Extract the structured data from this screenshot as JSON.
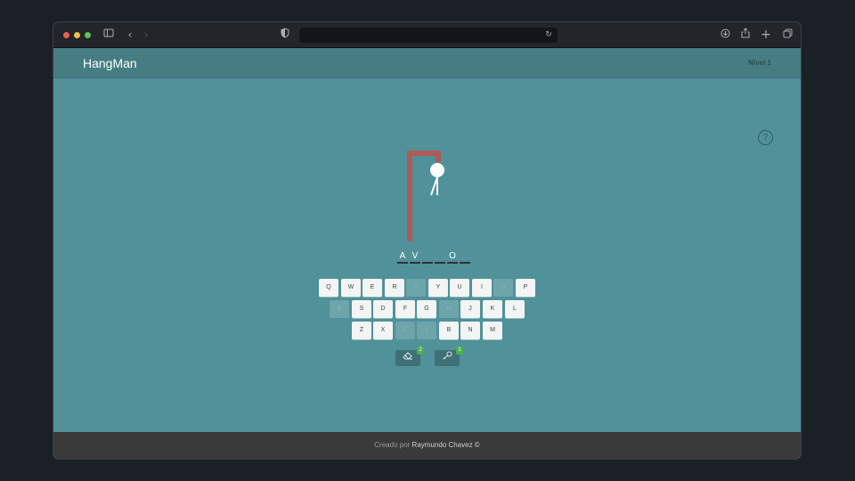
{
  "browser": {
    "icons": {
      "sidebar": "sidebar-icon",
      "back": "back-icon",
      "forward": "forward-icon",
      "shield": "shield-icon",
      "reload": "reload-icon",
      "download": "download-icon",
      "share": "share-icon",
      "new_tab": "plus-icon",
      "tabs": "tabs-icon"
    },
    "url": ""
  },
  "navbar": {
    "brand": "HangMan",
    "level": "Nivel 1"
  },
  "help": {
    "label": "?"
  },
  "word": {
    "slots": [
      "A",
      "V",
      "",
      "",
      "O",
      ""
    ]
  },
  "keyboard": {
    "row1": [
      {
        "label": "Q",
        "used": false
      },
      {
        "label": "W",
        "used": false
      },
      {
        "label": "E",
        "used": false
      },
      {
        "label": "R",
        "used": false
      },
      {
        "label": "T",
        "used": true
      },
      {
        "label": "Y",
        "used": false
      },
      {
        "label": "U",
        "used": false
      },
      {
        "label": "I",
        "used": false
      },
      {
        "label": "O",
        "used": true
      },
      {
        "label": "P",
        "used": false
      }
    ],
    "row2": [
      {
        "label": "A",
        "used": true
      },
      {
        "label": "S",
        "used": false
      },
      {
        "label": "D",
        "used": false
      },
      {
        "label": "F",
        "used": false
      },
      {
        "label": "G",
        "used": false
      },
      {
        "label": "H",
        "used": true
      },
      {
        "label": "J",
        "used": false
      },
      {
        "label": "K",
        "used": false
      },
      {
        "label": "L",
        "used": false
      }
    ],
    "row3": [
      {
        "label": "Z",
        "used": false
      },
      {
        "label": "X",
        "used": false
      },
      {
        "label": "C",
        "used": true
      },
      {
        "label": "V",
        "used": true
      },
      {
        "label": "B",
        "used": false
      },
      {
        "label": "N",
        "used": false
      },
      {
        "label": "M",
        "used": false
      }
    ]
  },
  "hints": {
    "eraser": {
      "icon": "eraser-icon",
      "count": "2"
    },
    "key": {
      "icon": "key-icon",
      "count": "1"
    }
  },
  "footer": {
    "prefix": "Creado por",
    "author": "Raymundo Chavez ©"
  },
  "colors": {
    "background": "#50919a",
    "navbar": "#467d83",
    "gallows": "#b05a55",
    "footer": "#3a3a3a"
  }
}
